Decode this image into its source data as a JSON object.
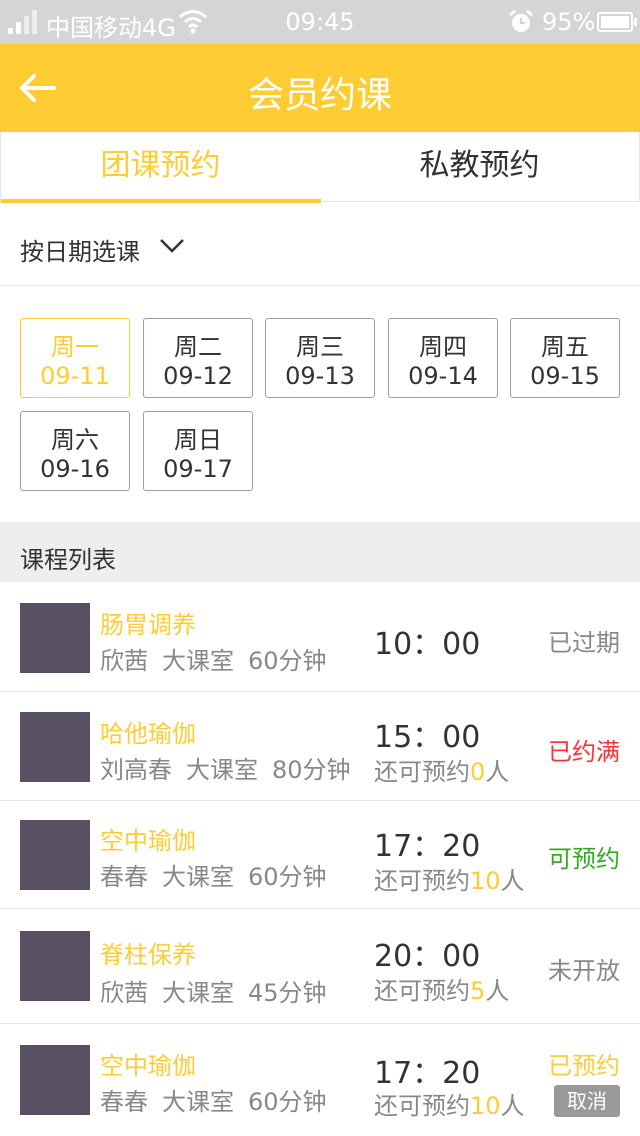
{
  "status_bar": {
    "carrier": "中国移动4G",
    "time": "09:45",
    "battery": "95%",
    "icons": [
      "signal-icon",
      "wifi-icon",
      "alarm-icon",
      "battery-icon"
    ]
  },
  "header": {
    "title": "会员约课",
    "back_icon": "back-arrow-icon",
    "color": "#ffcc33"
  },
  "tabs": [
    {
      "label": "团课预约",
      "active": true
    },
    {
      "label": "私教预约",
      "active": false
    }
  ],
  "filter": {
    "label": "按日期选课",
    "icon": "chevron-down-icon"
  },
  "days": [
    {
      "weekday": "周一",
      "date": "09-11",
      "active": true
    },
    {
      "weekday": "周二",
      "date": "09-12",
      "active": false
    },
    {
      "weekday": "周三",
      "date": "09-13",
      "active": false
    },
    {
      "weekday": "周四",
      "date": "09-14",
      "active": false
    },
    {
      "weekday": "周五",
      "date": "09-15",
      "active": false
    },
    {
      "weekday": "周六",
      "date": "09-16",
      "active": false
    },
    {
      "weekday": "周日",
      "date": "09-17",
      "active": false
    }
  ],
  "section": {
    "label": "课程列表"
  },
  "courses": [
    {
      "name": "肠胃调养",
      "coach": "欣茜",
      "room": "大课室",
      "duration": "60分钟",
      "time": "10：00",
      "remaining_prefix": "",
      "remaining_count": "",
      "remaining_suffix": "",
      "status": "已过期",
      "status_color": "#888888"
    },
    {
      "name": "哈他瑜伽",
      "coach": "刘高春",
      "room": "大课室",
      "duration": "80分钟",
      "time": "15：00",
      "remaining_prefix": "还可预约",
      "remaining_count": "0",
      "remaining_suffix": "人",
      "status": "已约满",
      "status_color": "#ff3333"
    },
    {
      "name": "空中瑜伽",
      "coach": "春春",
      "room": "大课室",
      "duration": "60分钟",
      "time": "17：20",
      "remaining_prefix": "还可预约",
      "remaining_count": "10",
      "remaining_suffix": "人",
      "status": "可预约",
      "status_color": "#33aa22"
    },
    {
      "name": "脊柱保养",
      "coach": "欣茜",
      "room": "大课室",
      "duration": "45分钟",
      "time": "20：00",
      "remaining_prefix": "还可预约",
      "remaining_count": "5",
      "remaining_suffix": "人",
      "status": "未开放",
      "status_color": "#888888"
    },
    {
      "name": "空中瑜伽",
      "coach": "春春",
      "room": "大课室",
      "duration": "60分钟",
      "time": "17：20",
      "remaining_prefix": "还可预约",
      "remaining_count": "10",
      "remaining_suffix": "人",
      "status": "已预约",
      "status_color": "#ffcc33",
      "action": "取消"
    }
  ]
}
